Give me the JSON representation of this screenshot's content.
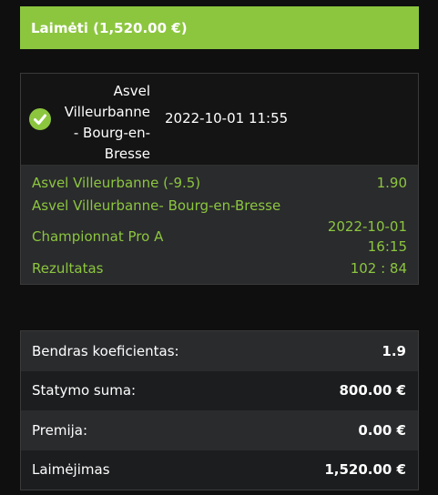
{
  "banner": {
    "text": "Laimėti (1,520.00 €)"
  },
  "bet": {
    "status_icon": "check-circle-icon",
    "match_name": "Asvel Villeurbanne - Bourg-en-Bresse",
    "match_datetime": "2022-10-01 11:55",
    "selection": "Asvel Villeurbanne (-9.5)",
    "odds": "1.90",
    "event": "Asvel Villeurbanne- Bourg-en-Bresse",
    "league": "Championnat Pro A",
    "league_date": "2022-10-01",
    "league_time": "16:15",
    "result_label": "Rezultatas",
    "result_value": "102 : 84"
  },
  "summary": {
    "total_odds_label": "Bendras koeficientas:",
    "total_odds_value": "1.9",
    "stake_label": "Statymo suma:",
    "stake_value": "800.00 €",
    "bonus_label": "Premija:",
    "bonus_value": "0.00 €",
    "winnings_label": "Laimėjimas",
    "winnings_value": "1,520.00 €"
  },
  "colors": {
    "accent": "#8cc63f",
    "background": "#0f0f0f",
    "panel": "#2a2b2d"
  }
}
